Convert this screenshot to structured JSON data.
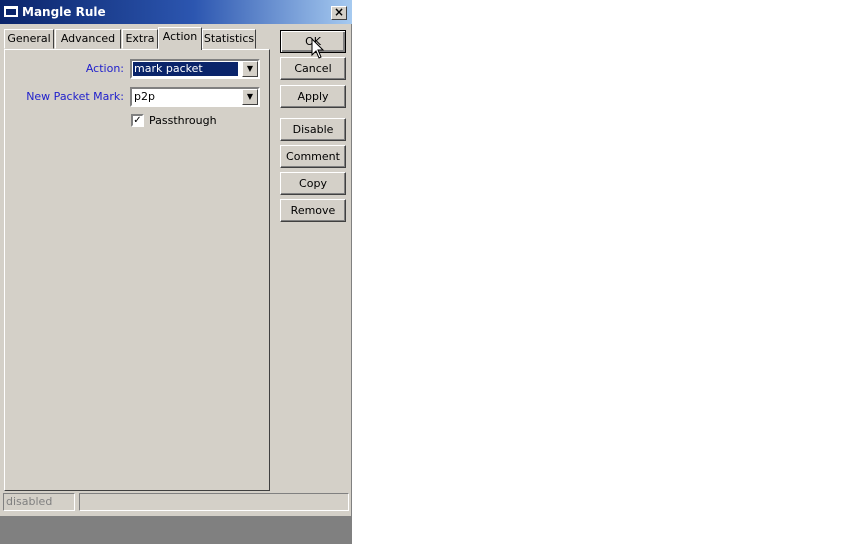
{
  "window": {
    "title": "Mangle Rule",
    "close_glyph": "×"
  },
  "tabs": [
    {
      "label": "General",
      "active": false
    },
    {
      "label": "Advanced",
      "active": false
    },
    {
      "label": "Extra",
      "active": false
    },
    {
      "label": "Action",
      "active": true
    },
    {
      "label": "Statistics",
      "active": false
    }
  ],
  "form": {
    "action_label": "Action:",
    "action_value": "mark packet",
    "packet_mark_label": "New Packet Mark:",
    "packet_mark_value": "p2p",
    "passthrough_label": "Passthrough",
    "passthrough_checked": true
  },
  "buttons": {
    "ok": "OK",
    "cancel": "Cancel",
    "apply": "Apply",
    "disable": "Disable",
    "comment": "Comment",
    "copy": "Copy",
    "remove": "Remove"
  },
  "status": {
    "state": "disabled",
    "info": ""
  },
  "icons": {
    "dropdown": "▼",
    "check": "✓"
  },
  "colors": {
    "title_bar": "#0a246a",
    "label_blue": "#1f1fcc",
    "face": "#d4d0c8",
    "selection": "#0a246a"
  }
}
